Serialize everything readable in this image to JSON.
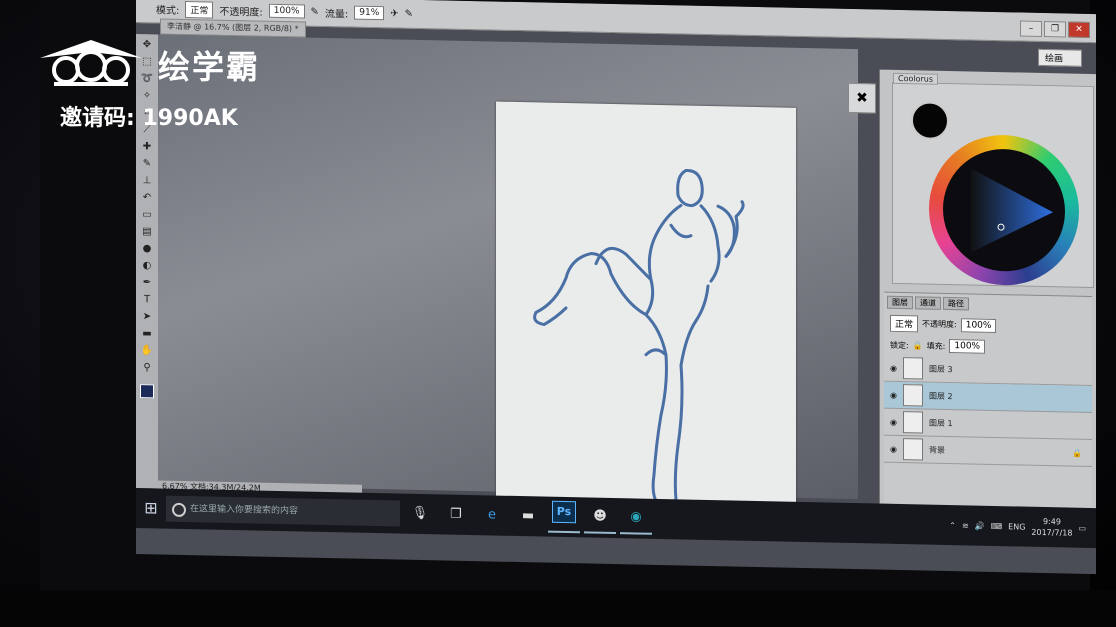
{
  "watermark": {
    "brand_name": "绘学霸",
    "invite_label": "邀请码: 1990AK"
  },
  "photoshop": {
    "options_bar": {
      "mode_label": "模式:",
      "mode_value": "正常",
      "opacity_label": "不透明度:",
      "opacity_value": "100%",
      "flow_label": "流量:",
      "flow_value": "91%"
    },
    "document_tab": "李洁静 @ 16.7% (图层 2, RGB/8) *",
    "workspace": "绘画",
    "status_bar": "6.67%    文档:34.3M/24.2M",
    "tools": [
      "move",
      "marquee",
      "lasso",
      "wand",
      "crop",
      "eyedropper",
      "heal",
      "brush",
      "stamp",
      "history",
      "eraser",
      "gradient",
      "blur",
      "dodge",
      "pen",
      "type",
      "path",
      "shape",
      "hand",
      "zoom"
    ],
    "coolorus": {
      "title": "Coolorus"
    },
    "layers_panel": {
      "tabs": [
        "图层",
        "通道",
        "路径"
      ],
      "blend_mode": "正常",
      "opacity_label": "不透明度:",
      "opacity_value": "100%",
      "lock_label": "锁定:",
      "fill_label": "填充:",
      "fill_value": "100%",
      "layers": [
        {
          "name": "图层 3",
          "selected": false
        },
        {
          "name": "图层 2",
          "selected": true
        },
        {
          "name": "图层 1",
          "selected": false
        },
        {
          "name": "背景",
          "selected": false
        }
      ]
    }
  },
  "taskbar": {
    "search_placeholder": "在这里输入你要搜索的内容",
    "language": "ENG",
    "time": "9:49",
    "date": "2017/7/18"
  },
  "colors": {
    "stroke": "#4a6fa5",
    "foreground": "#1c2a5a"
  }
}
